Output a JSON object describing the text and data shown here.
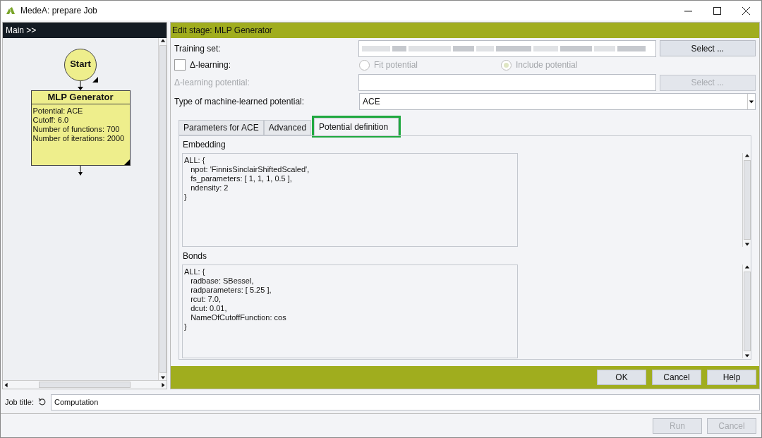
{
  "window": {
    "title": "MedeA: prepare Job"
  },
  "flow_panel": {
    "header": "Main >>",
    "start_node": {
      "label": "Start"
    },
    "stages": [
      {
        "title": "MLP Generator",
        "lines": [
          "Potential: ACE",
          "Cutoff: 6.0",
          "Number of functions: 700",
          "Number of iterations: 2000"
        ]
      }
    ]
  },
  "editor": {
    "header": "Edit stage: MLP Generator",
    "training_set": {
      "label": "Training set:",
      "value_obscured": true,
      "button": "Select ...",
      "button_disabled": false
    },
    "delta_learning": {
      "label": "Δ-learning:",
      "checked": false
    },
    "delta_options": [
      {
        "label": "Fit potential",
        "selected": false,
        "disabled": true
      },
      {
        "label": "Include potential",
        "selected": true,
        "disabled": true
      }
    ],
    "delta_potential": {
      "label": "Δ-learning potential:",
      "disabled": true,
      "button": "Select ...",
      "button_disabled": true
    },
    "potential_type": {
      "label": "Type of machine-learned potential:",
      "value": "ACE"
    },
    "tabs": [
      {
        "label": "Parameters for ACE",
        "selected": false,
        "highlighted": false
      },
      {
        "label": "Advanced",
        "selected": false,
        "highlighted": false
      },
      {
        "label": "Potential definition",
        "selected": true,
        "highlighted": true
      }
    ],
    "sections": [
      {
        "label": "Embedding",
        "code": "ALL: {\n   npot: 'FinnisSinclairShiftedScaled',\n   fs_parameters: [ 1, 1, 1, 0.5 ],\n   ndensity: 2\n}"
      },
      {
        "label": "Bonds",
        "code": "ALL: {\n   radbase: SBessel,\n   radparameters: [ 5.25 ],\n   rcut: 7.0,\n   dcut: 0.01,\n   NameOfCutoffFunction: cos\n}"
      }
    ],
    "buttons": [
      {
        "label": "OK",
        "disabled": false
      },
      {
        "label": "Cancel",
        "disabled": false
      },
      {
        "label": "Help",
        "disabled": false
      }
    ]
  },
  "job_title": {
    "label": "Job title:",
    "value": "Computation"
  },
  "footer_buttons": [
    {
      "label": "Run",
      "disabled": true
    },
    {
      "label": "Cancel",
      "disabled": true
    }
  ]
}
